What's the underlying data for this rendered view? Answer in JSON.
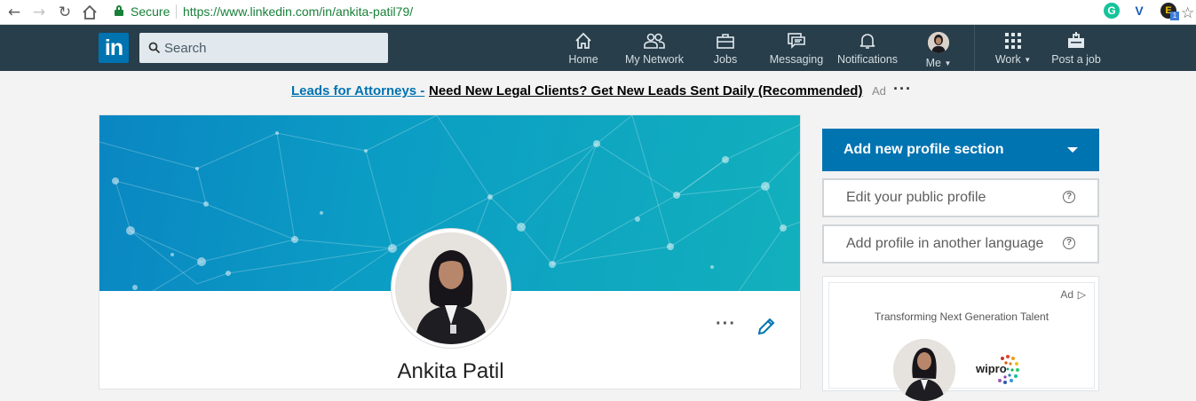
{
  "browser": {
    "secure_label": "Secure",
    "url": "https://www.linkedin.com/in/ankita-patil79/",
    "extension_badge": "1"
  },
  "header": {
    "logo_text": "in",
    "search_placeholder": "Search",
    "nav": {
      "home": "Home",
      "my_network": "My Network",
      "jobs": "Jobs",
      "messaging": "Messaging",
      "notifications": "Notifications",
      "me": "Me",
      "work": "Work",
      "post_job": "Post a job"
    },
    "colors": {
      "bar": "#283e4a",
      "brand": "#0073b1"
    }
  },
  "ad_line": {
    "link": "Leads for Attorneys -",
    "text": "Need New Legal Clients? Get New Leads Sent Daily (Recommended)",
    "tag": "Ad",
    "more": "···"
  },
  "profile": {
    "name": "Ankita Patil",
    "more": "···"
  },
  "sidebar": {
    "add_section": "Add new profile section",
    "edit_public": "Edit your public profile",
    "add_language": "Add profile in another language",
    "help_glyph": "?",
    "ad": {
      "tag": "Ad",
      "play": "▷",
      "headline": "Transforming Next Generation Talent",
      "company": "wipro"
    }
  }
}
